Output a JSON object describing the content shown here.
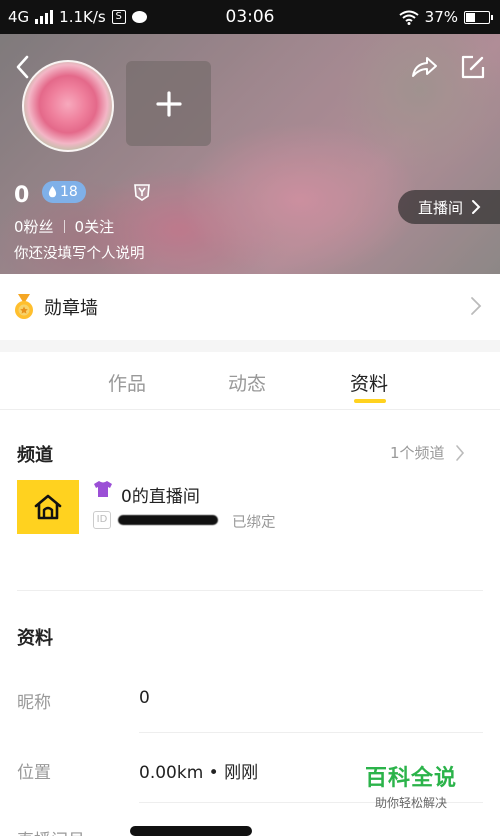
{
  "status_bar": {
    "network": "4G",
    "speed": "1.1K/s",
    "s_icon": "S",
    "time": "03:06",
    "battery": "37%"
  },
  "profile": {
    "username": "0",
    "level": "18",
    "fans_label": "0粉丝",
    "following_label": "0关注",
    "bio": "你还没填写个人说明",
    "live_room_button": "直播间"
  },
  "medal_wall": {
    "label": "勋章墙"
  },
  "tabs": [
    {
      "label": "作品",
      "active": false
    },
    {
      "label": "动态",
      "active": false
    },
    {
      "label": "资料",
      "active": true
    }
  ],
  "channel": {
    "title": "频道",
    "count": "1个频道",
    "name": "0的直播间",
    "bound_label": "已绑定"
  },
  "info": {
    "title": "资料",
    "rows": [
      {
        "label": "昵称",
        "value": "0"
      },
      {
        "label": "位置",
        "value": "0.00km • 刚刚"
      },
      {
        "label": "直播间号",
        "value": ""
      }
    ]
  },
  "watermark": {
    "main": "百科全说",
    "sub": "助你轻松解决"
  },
  "colors": {
    "accent": "#ffd21f",
    "level_badge": "#7fb0e8",
    "watermark": "#2bb34a"
  }
}
